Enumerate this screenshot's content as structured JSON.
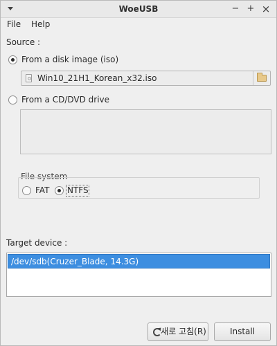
{
  "window": {
    "title": "WoeUSB",
    "minimize_glyph": "−",
    "maximize_glyph": "+",
    "close_glyph": "×"
  },
  "menu": {
    "file": "File",
    "help": "Help"
  },
  "source": {
    "heading": "Source :",
    "disk_image_label": "From a disk image (iso)",
    "disk_image_selected": true,
    "iso_path": "Win10_21H1_Korean_x32.iso",
    "cd_label": "From a CD/DVD drive",
    "cd_selected": false
  },
  "filesystem": {
    "heading": "File system",
    "fat_label": "FAT",
    "ntfs_label": "NTFS",
    "selected": "NTFS"
  },
  "target": {
    "heading": "Target device :",
    "devices": [
      {
        "label": "/dev/sdb(Cruzer_Blade, 14.3G)",
        "selected": true
      }
    ]
  },
  "buttons": {
    "refresh": "새로 고침(R)",
    "install": "Install"
  },
  "icons": {
    "window_menu": "chevron-down-icon",
    "iso_file": "disk-icon",
    "browse": "folder-icon",
    "refresh": "refresh-icon"
  },
  "colors": {
    "selection": "#3d8ee0",
    "window_bg": "#efefef"
  }
}
